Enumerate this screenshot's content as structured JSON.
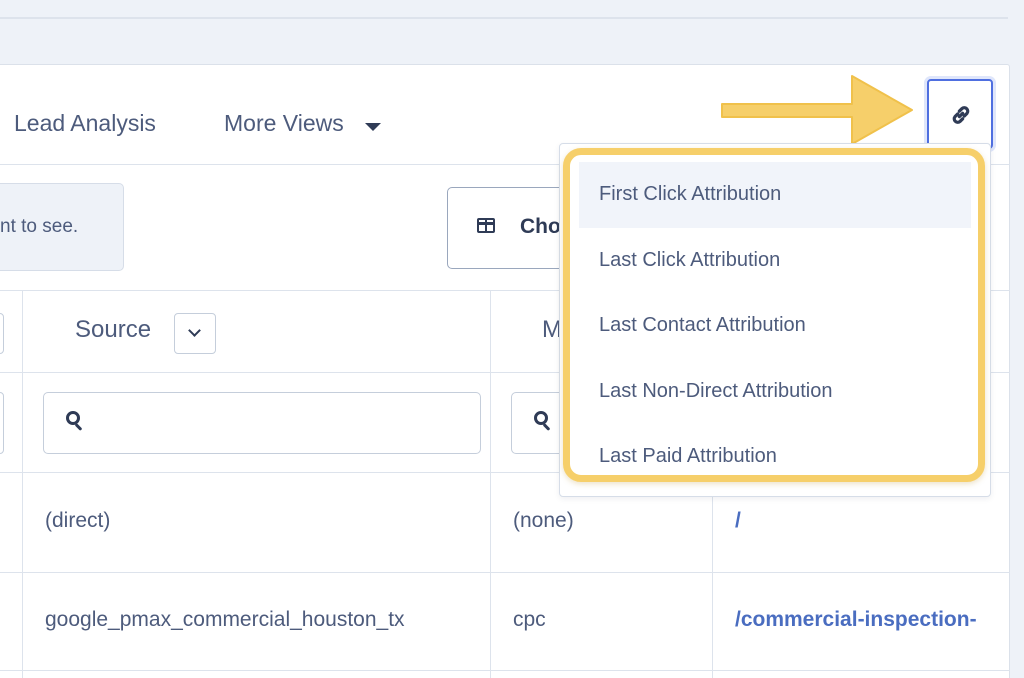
{
  "tabs": [
    {
      "label": "Lead Analysis"
    },
    {
      "label": "More Views"
    }
  ],
  "info": {
    "text": "nt to see."
  },
  "toolbar": {
    "choose_label": "Cho"
  },
  "table": {
    "headers": {
      "source": "Source",
      "medium": "M"
    },
    "filters": {
      "source_placeholder": "",
      "medium_placeholder": ""
    },
    "rows": [
      {
        "source": "(direct)",
        "medium": "(none)",
        "landing": "/"
      },
      {
        "source": "google_pmax_commercial_houston_tx",
        "medium": "cpc",
        "landing": "/commercial-inspection-"
      }
    ]
  },
  "attribution_menu": {
    "items": [
      {
        "label": "First Click Attribution"
      },
      {
        "label": "Last Click Attribution"
      },
      {
        "label": "Last Contact Attribution"
      },
      {
        "label": "Last Non-Direct Attribution"
      },
      {
        "label": "Last Paid Attribution"
      }
    ]
  },
  "colors": {
    "accent": "#4f6fe0",
    "highlight": "#f6cf6a",
    "link": "#4a6dc0",
    "text": "#4d5b7c",
    "background": "#eef2f8"
  },
  "icons": [
    "link-icon",
    "columns-icon",
    "search-icon",
    "chevron-down-icon",
    "caret-down-icon",
    "arrow-annotation"
  ]
}
